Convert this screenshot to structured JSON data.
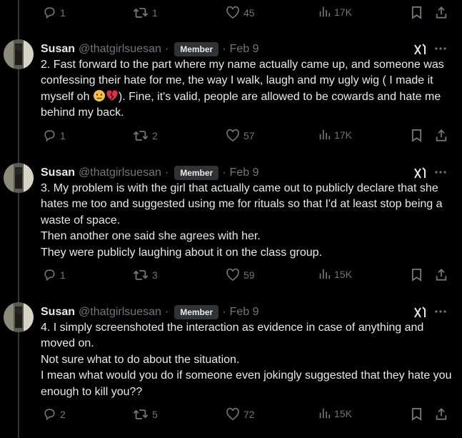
{
  "top_actions": {
    "replies": "1",
    "reposts": "1",
    "likes": "45",
    "views": "17K"
  },
  "posts": [
    {
      "name": "Susan",
      "handle": "@thatgirlsuesan",
      "sep": "·",
      "badge": "Member",
      "date": "Feb 9",
      "text_a": "2. Fast forward to the part where my name actually came up, and someone was confessing their hate for me, the way I walk, laugh and my ugly wig ( I made it myself oh ",
      "text_b": "). Fine, it's valid, people are allowed to be cowards and hate me behind my back.",
      "replies": "1",
      "reposts": "2",
      "likes": "57",
      "views": "17K"
    },
    {
      "name": "Susan",
      "handle": "@thatgirlsuesan",
      "sep": "·",
      "badge": "Member",
      "date": "Feb 9",
      "lines": [
        "3. My problem is with the girl that actually came out to publicly declare that she hates me too and suggested using me for rituals so that I'd at least stop being a waste of space.",
        "Then another one said she agrees with her.",
        "They were publicly laughing about it on the class group."
      ],
      "replies": "1",
      "reposts": "3",
      "likes": "59",
      "views": "15K"
    },
    {
      "name": "Susan",
      "handle": "@thatgirlsuesan",
      "sep": "·",
      "badge": "Member",
      "date": "Feb 9",
      "lines": [
        "4. I simply screenshoted the interaction as evidence in case of anything and moved on.",
        "Not sure what to do about the situation.",
        "I mean what would you do if someone even jokingly suggested that they hate you enough to kill you??"
      ],
      "replies": "2",
      "reposts": "5",
      "likes": "72",
      "views": "15K"
    }
  ],
  "icons": {
    "reply": "reply-icon",
    "repost": "repost-icon",
    "like": "heart-icon",
    "views": "analytics-icon",
    "bookmark": "bookmark-icon",
    "share": "share-icon",
    "grok": "grok-icon",
    "more": "more-icon"
  }
}
